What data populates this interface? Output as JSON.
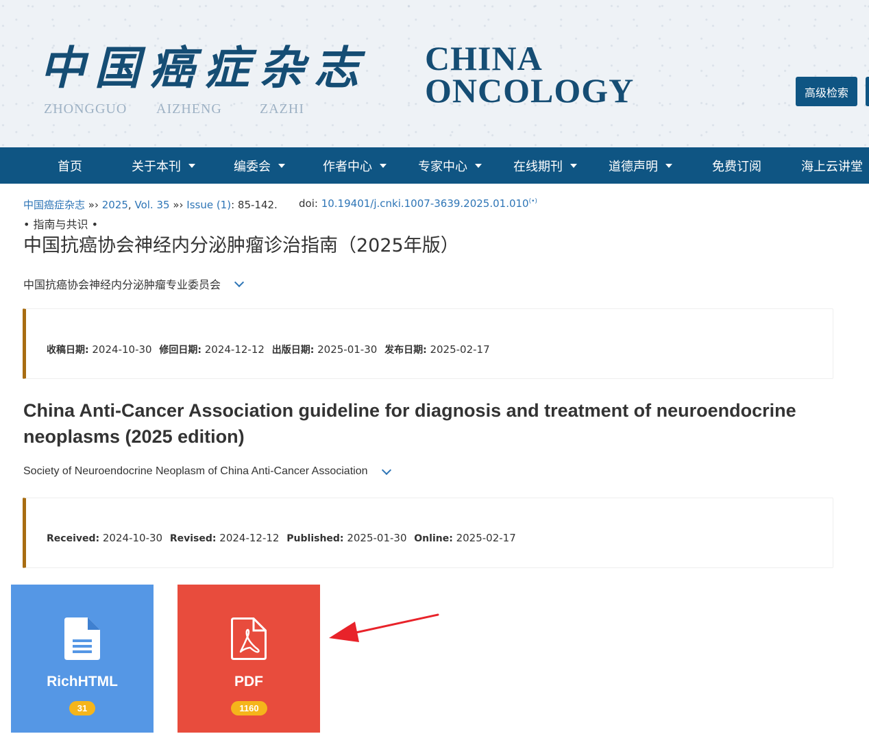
{
  "header": {
    "logo_cn": "中国癌症杂志",
    "logo_pinyin": [
      "ZHONGGUO",
      "AIZHENG",
      "ZAZHI"
    ],
    "logo_en_line1": "CHINA",
    "logo_en_line2": "ONCOLOGY",
    "advanced_search_label": "高级检索"
  },
  "nav": {
    "items": [
      {
        "label": "首页"
      },
      {
        "label": "关于本刊"
      },
      {
        "label": "编委会"
      },
      {
        "label": "作者中心"
      },
      {
        "label": "专家中心"
      },
      {
        "label": "在线期刊"
      },
      {
        "label": "道德声明"
      },
      {
        "label": "免费订阅"
      },
      {
        "label": "海上云讲堂"
      }
    ]
  },
  "breadcrumb": {
    "journal": "中国癌症杂志",
    "sep1": " »› ",
    "year": "2025",
    "comma": ", ",
    "volume": "Vol. 35",
    "sep2": " »› ",
    "issue": "Issue (1)",
    "pages": ": 85-142."
  },
  "doi": {
    "label": "doi: ",
    "value": "10.19401/j.cnki.1007-3639.2025.01.010",
    "sup": "(•)"
  },
  "article": {
    "category": "• 指南与共识 •",
    "title_cn": "中国抗癌协会神经内分泌肿瘤诊治指南（2025年版）",
    "authors_cn": "中国抗癌协会神经内分泌肿瘤专业委员会",
    "title_en": "China Anti-Cancer Association guideline for diagnosis and treatment of neuroendocrine neoplasms (2025 edition)",
    "authors_en": "Society of Neuroendocrine Neoplasm of China Anti-Cancer Association"
  },
  "dates_cn": {
    "received_label": "收稿日期:",
    "received": "2024-10-30",
    "revised_label": "修回日期:",
    "revised": "2024-12-12",
    "published_label": "出版日期:",
    "published": "2025-01-30",
    "online_label": "发布日期:",
    "online": "2025-02-17"
  },
  "dates_en": {
    "received_label": "Received:",
    "received": "2024-10-30",
    "revised_label": "Revised:",
    "revised": "2024-12-12",
    "published_label": "Published:",
    "published": "2025-01-30",
    "online_label": "Online:",
    "online": "2025-02-17"
  },
  "tiles": {
    "richhtml": {
      "label": "RichHTML",
      "count": "31",
      "color": "#5597e5",
      "icon": "document-icon"
    },
    "pdf": {
      "label": "PDF",
      "count": "1160",
      "color": "#e84c3d",
      "icon": "pdf-icon"
    }
  },
  "colors": {
    "nav_bg": "#0f5583",
    "link": "#2e75b6",
    "date_box_accent": "#a86d12",
    "badge": "#f5b51b",
    "annotation_arrow": "#e8232a"
  }
}
